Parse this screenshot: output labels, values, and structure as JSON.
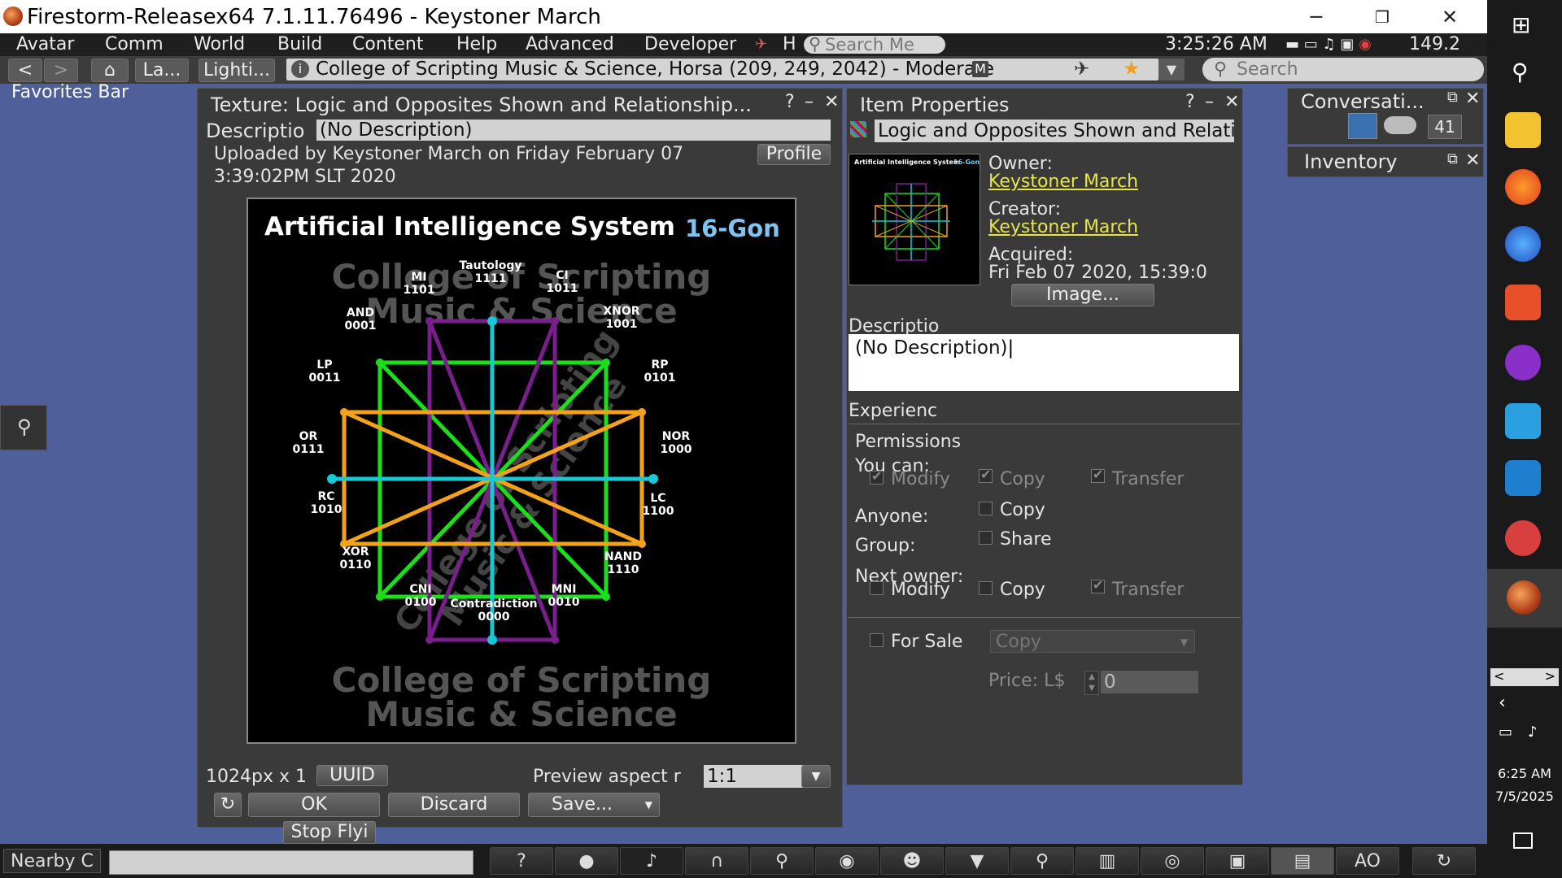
{
  "window": {
    "title": "Firestorm-Releasex64 7.1.11.76496 - Keystoner March",
    "minimize": "─",
    "restore": "❐",
    "close": "✕"
  },
  "menu": {
    "items": [
      "Avatar",
      "Comm",
      "World",
      "Build",
      "Content",
      "Help",
      "Advanced",
      "Developer"
    ],
    "h_label": "H",
    "search_placeholder": "Search Me",
    "clock": "3:25:26 AM",
    "balance": "149.2"
  },
  "nav": {
    "back": "<",
    "forward": ">",
    "landmarks_label": "La...",
    "lighting_label": "Lighti...",
    "location": "College of Scripting Music & Science, Horsa (209, 249, 2042) - Moderate",
    "maturity_badge": "M",
    "search_placeholder": "Search"
  },
  "favorites_bar": "Favorites Bar",
  "texture_floater": {
    "title": "Texture: Logic and Opposites Shown and Relationship...",
    "help": "?",
    "minimize": "–",
    "close": "✕",
    "description_label": "Descriptio",
    "description_value": "(No Description)",
    "uploaded_line1": "Uploaded by Keystoner March on Friday February 07",
    "uploaded_line2": "3:39:02PM SLT 2020",
    "profile_button": "Profile",
    "size_text": "1024px x 1",
    "uuid_button": "UUID",
    "preview_aspect_label": "Preview aspect r",
    "preview_aspect_value": "1:1",
    "ok_button": "OK",
    "discard_button": "Discard",
    "save_button": "Save...",
    "stop_flying": "Stop Flyi"
  },
  "texture_image": {
    "title_main": "Artificial Intelligence System",
    "title_accent": "16-Gon",
    "watermark_top_1": "College of Scripting",
    "watermark_top_2": "Music & Science",
    "watermark_bottom_1": "College of Scripting",
    "watermark_bottom_2": "Music & Science",
    "watermark_diag_1": "College of Scripting",
    "watermark_diag_2": "Music & Science",
    "labels": {
      "tautology": [
        "Tautology",
        "1111"
      ],
      "mi": [
        "MI",
        "1101"
      ],
      "ci": [
        "CI",
        "1011"
      ],
      "and": [
        "AND",
        "0001"
      ],
      "xnor": [
        "XNOR",
        "1001"
      ],
      "lp": [
        "LP",
        "0011"
      ],
      "rp": [
        "RP",
        "0101"
      ],
      "or": [
        "OR",
        "0111"
      ],
      "nor": [
        "NOR",
        "1000"
      ],
      "rc": [
        "RC",
        "1010"
      ],
      "lc": [
        "LC",
        "1100"
      ],
      "xor": [
        "XOR",
        "0110"
      ],
      "nand": [
        "NAND",
        "1110"
      ],
      "cni": [
        "CNI",
        "0100"
      ],
      "mni": [
        "MNI",
        "0010"
      ],
      "contradiction": [
        "Contradiction",
        "0000"
      ]
    },
    "colors": {
      "cyan": "#16c8d8",
      "purple": "#7a1e8e",
      "green": "#19e019",
      "orange": "#f4a21a"
    }
  },
  "item_properties": {
    "title": "Item Properties",
    "help": "?",
    "minimize": "–",
    "close": "✕",
    "name": "Logic and Opposites Shown and Relation",
    "owner_label": "Owner:",
    "owner": "Keystoner March",
    "creator_label": "Creator:",
    "creator": "Keystoner March",
    "acquired_label": "Acquired:",
    "acquired": "Fri Feb 07 2020, 15:39:0",
    "image_button": "Image...",
    "thumb_title": "Artificial Intelligence System",
    "thumb_accent": "16-Gon",
    "description_label": "Descriptio",
    "description_value": "(No Description)",
    "experience_label": "Experienc",
    "permissions_label": "Permissions",
    "you_can_label": "You can:",
    "modify": "Modify",
    "copy": "Copy",
    "transfer": "Transfer",
    "anyone_label": "Anyone:",
    "group_label": "Group:",
    "share": "Share",
    "next_owner_label": "Next owner:",
    "for_sale": "For Sale",
    "sale_type": "Copy",
    "price_label": "Price: L$",
    "price_value": "0"
  },
  "conversations": {
    "title": "Conversati...",
    "count": "41"
  },
  "inventory": {
    "title": "Inventory"
  },
  "bottom": {
    "nearby_chat": "Nearby C",
    "ao_label": "AO"
  },
  "taskbar": {
    "time": "6:25 AM",
    "date": "7/5/2025"
  }
}
